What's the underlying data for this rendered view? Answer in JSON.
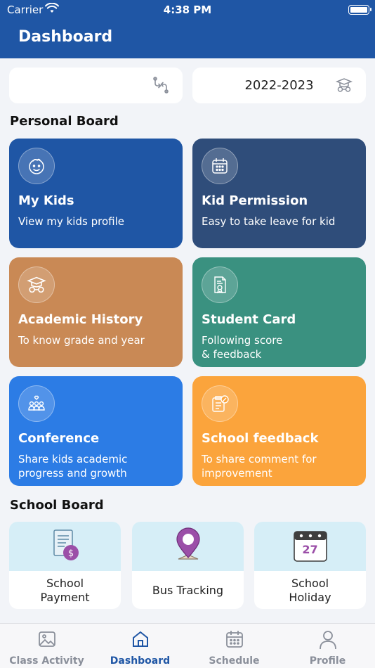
{
  "status_bar": {
    "carrier": "Carrier",
    "time": "4:38 PM"
  },
  "header": {
    "title": "Dashboard"
  },
  "selectors": {
    "kid": {
      "value": "",
      "icon": "swap-icon"
    },
    "year": {
      "value": "2022-2023",
      "icon": "graduation-glasses-icon"
    }
  },
  "personal_board": {
    "title": "Personal Board",
    "cards": [
      {
        "title": "My Kids",
        "subtitle": "View my kids profile",
        "icon": "kid-face-icon",
        "color": "#1f56a5"
      },
      {
        "title": "Kid Permission",
        "subtitle": "Easy to take leave for kid",
        "icon": "calendar-icon",
        "color": "#2f4d7a"
      },
      {
        "title": "Academic History",
        "subtitle": "To know grade and year",
        "icon": "graduation-glasses-icon",
        "color": "#c98955"
      },
      {
        "title": "Student Card",
        "subtitle": "Following score\n& feedback",
        "icon": "certificate-icon",
        "color": "#3a9180"
      },
      {
        "title": "Conference",
        "subtitle": "Share kids academic\nprogress and growth",
        "icon": "group-heart-icon",
        "color": "#2c7ce5"
      },
      {
        "title": "School feedback",
        "subtitle": "To share comment for\nimprovement",
        "icon": "feedback-edit-icon",
        "color": "#fba43c"
      }
    ]
  },
  "school_board": {
    "title": "School Board",
    "items": [
      {
        "label": "School\nPayment",
        "icon": "payment-receipt-icon"
      },
      {
        "label": "Bus Tracking",
        "icon": "location-pin-icon"
      },
      {
        "label": "School\nHoliday",
        "icon": "calendar-27-icon",
        "day": "27"
      }
    ]
  },
  "tab_bar": {
    "active": "Dashboard",
    "tabs": [
      {
        "label": "Class Activity",
        "icon": "image-icon"
      },
      {
        "label": "Dashboard",
        "icon": "home-icon"
      },
      {
        "label": "Schedule",
        "icon": "calendar-icon"
      },
      {
        "label": "Profile",
        "icon": "person-icon"
      }
    ]
  }
}
